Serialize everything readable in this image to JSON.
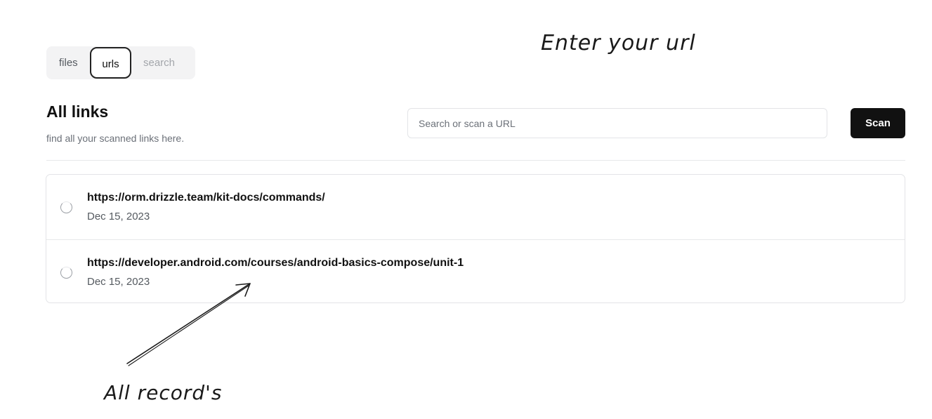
{
  "tabs": [
    {
      "label": "files",
      "active": false
    },
    {
      "label": "urls",
      "active": true
    },
    {
      "label": "search",
      "active": false
    }
  ],
  "header": {
    "title": "All links",
    "subtitle": "find all your scanned links here."
  },
  "search": {
    "placeholder": "Search or scan a URL",
    "value": ""
  },
  "scan_button": {
    "label": "Scan"
  },
  "links": [
    {
      "url": "https://orm.drizzle.team/kit-docs/commands/",
      "date": "Dec 15, 2023"
    },
    {
      "url": "https://developer.android.com/courses/android-basics-compose/unit-1",
      "date": "Dec 15, 2023"
    }
  ],
  "annotations": {
    "top": "Enter your url",
    "bottom": "All record's"
  },
  "colors": {
    "primary_button": "#111111",
    "tab_bar_bg": "#f3f3f4",
    "muted_text": "#6b7078"
  },
  "icons": {
    "radio": "radio-circle-icon",
    "arrow": "hand-drawn-arrow-icon"
  }
}
